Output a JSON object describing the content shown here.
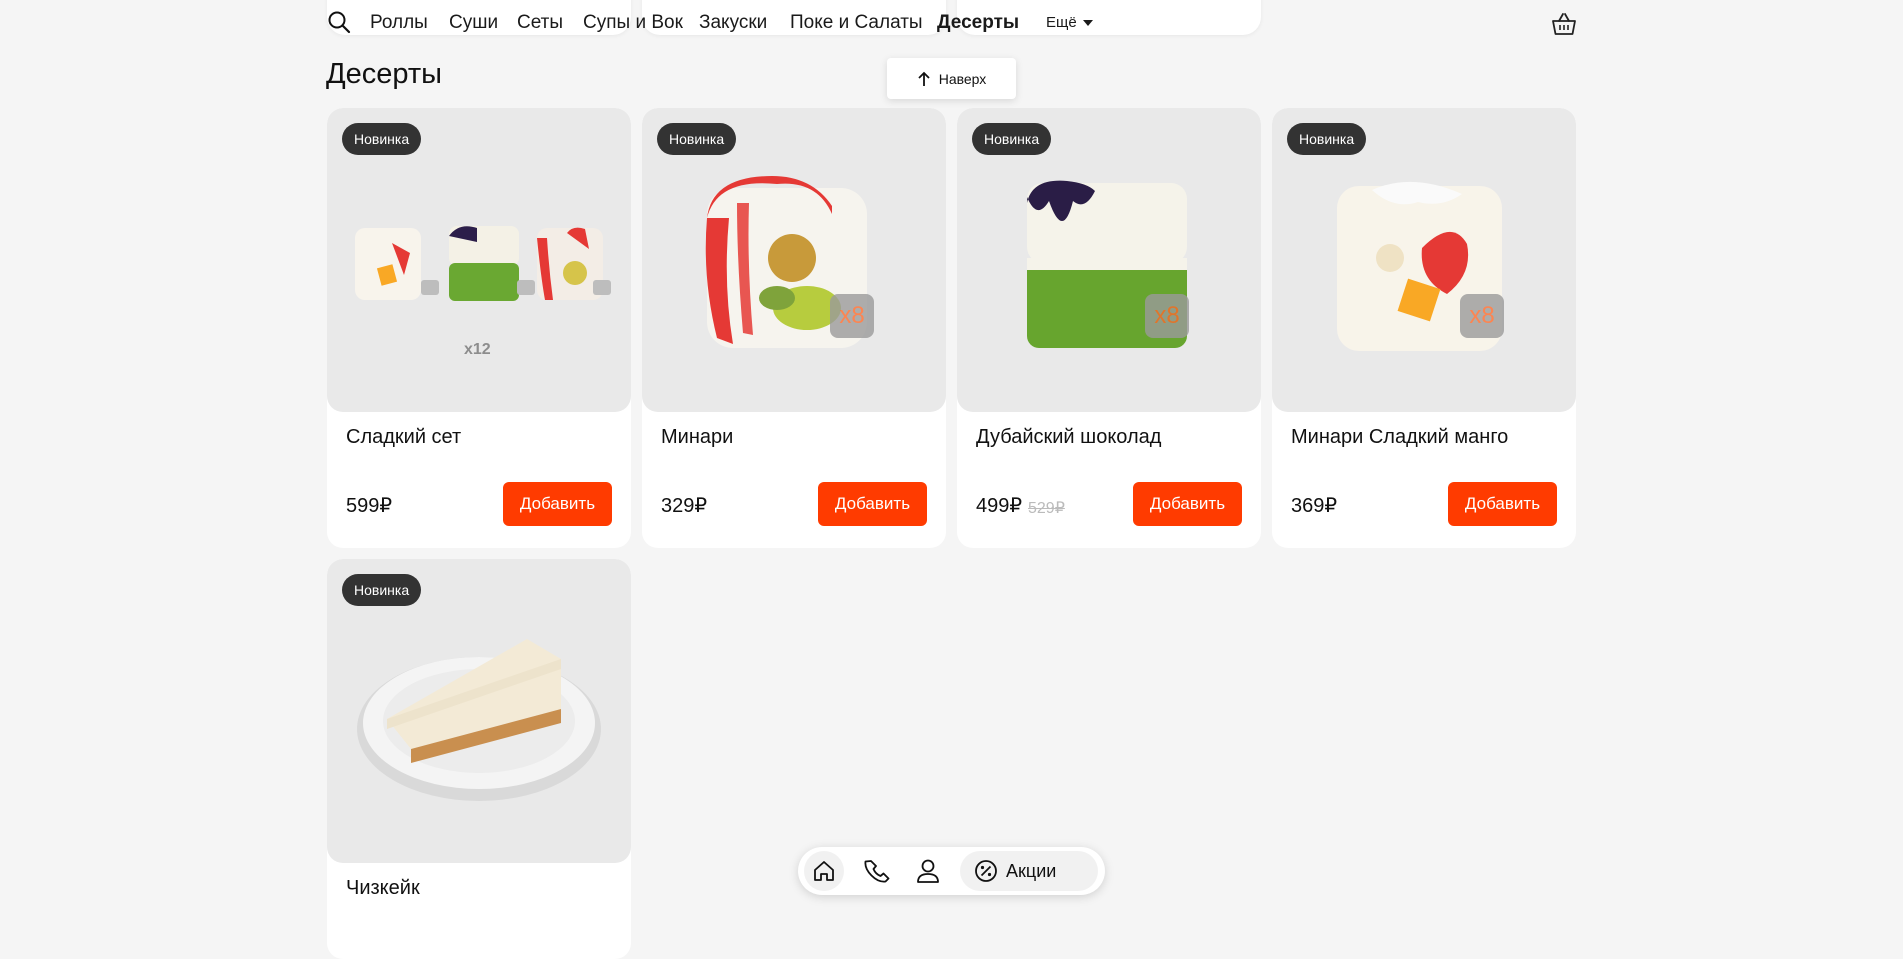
{
  "nav": {
    "items": [
      {
        "label": "Роллы"
      },
      {
        "label": "Суши"
      },
      {
        "label": "Сеты"
      },
      {
        "label": "Супы и Вок"
      },
      {
        "label": "Закуски"
      },
      {
        "label": "Поке и Салаты"
      },
      {
        "label": "Десерты",
        "active": true
      }
    ],
    "more_label": "Ещё",
    "search_icon": "search-icon",
    "basket_icon": "basket-icon"
  },
  "section": {
    "title": "Десерты",
    "to_top_label": "Наверх"
  },
  "products": [
    {
      "badge": "Новинка",
      "title": "Сладкий сет",
      "price": "599₽",
      "old_price": "",
      "button": "Добавить",
      "image_label": "x12"
    },
    {
      "badge": "Новинка",
      "title": "Минари",
      "price": "329₽",
      "old_price": "",
      "button": "Добавить",
      "image_label": "x8"
    },
    {
      "badge": "Новинка",
      "title": "Дубайский шоколад",
      "price": "499₽",
      "old_price": "529₽",
      "button": "Добавить",
      "image_label": "x8"
    },
    {
      "badge": "Новинка",
      "title": "Минари Сладкий манго",
      "price": "369₽",
      "old_price": "",
      "button": "Добавить",
      "image_label": "x8"
    },
    {
      "badge": "Новинка",
      "title": "Чизкейк",
      "price": "",
      "old_price": "",
      "button": "",
      "image_label": ""
    }
  ],
  "bottom_bar": {
    "promo_label": "Акции",
    "icons": [
      "home-icon",
      "phone-icon",
      "user-icon",
      "percent-icon"
    ]
  },
  "colors": {
    "accent": "#ff3b00",
    "badge_bg": "#333333",
    "page_bg": "#f5f5f5",
    "image_bg": "#e9e9e9"
  }
}
